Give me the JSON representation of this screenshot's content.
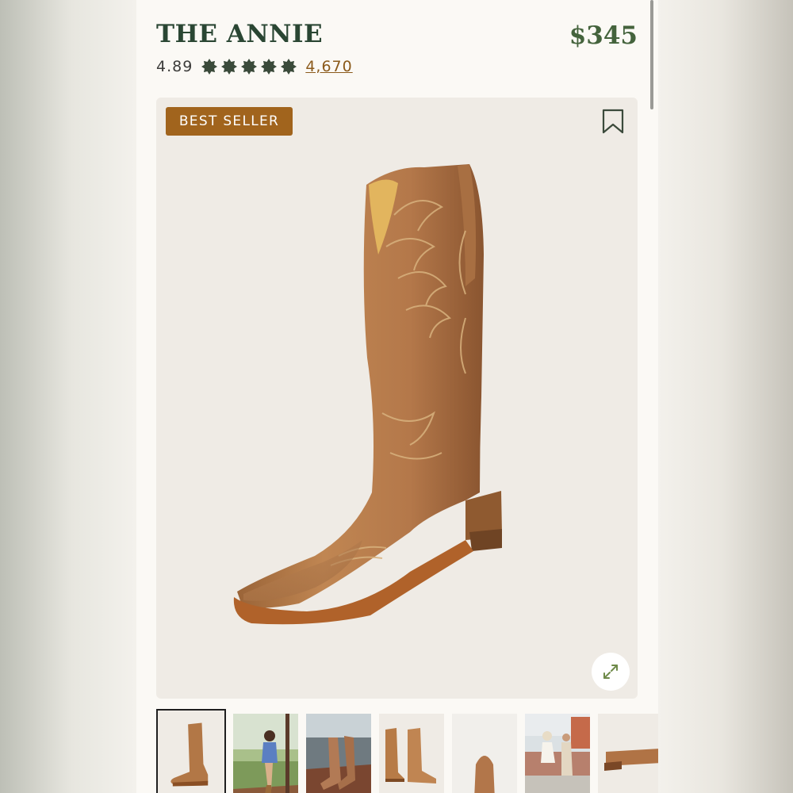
{
  "product": {
    "title": "THE ANNIE",
    "price": "$345",
    "rating": "4.89",
    "star_count": 5,
    "review_count": "4,670",
    "badge": "BEST SELLER"
  },
  "colors": {
    "title": "#2a4633",
    "price": "#44633c",
    "review_link": "#8b5a1b",
    "badge_bg": "#a1641d",
    "star": "#3a4a3a",
    "boot_leather": "#b57a4b"
  },
  "icons": {
    "bookmark": "bookmark-icon",
    "expand": "expand-icon",
    "star": "star-icon"
  },
  "gallery": {
    "selected_index": 0,
    "thumbnails": [
      {
        "name": "thumbnail-boot-side",
        "kind": "boot-side"
      },
      {
        "name": "thumbnail-model-outdoor",
        "kind": "model-outdoor"
      },
      {
        "name": "thumbnail-boots-on-feet",
        "kind": "boots-on-feet"
      },
      {
        "name": "thumbnail-boot-pair",
        "kind": "boot-pair"
      },
      {
        "name": "thumbnail-boot-toe",
        "kind": "boot-toe"
      },
      {
        "name": "thumbnail-dancing-couple",
        "kind": "dancing-couple"
      },
      {
        "name": "thumbnail-boot-heel",
        "kind": "boot-heel"
      }
    ]
  }
}
